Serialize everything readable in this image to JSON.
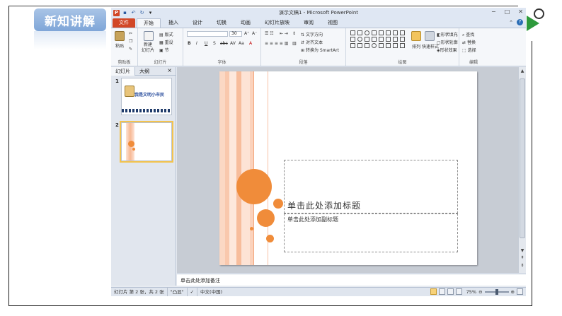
{
  "badge": {
    "label": "新知讲解"
  },
  "window": {
    "title": "演示文稿1 - Microsoft PowerPoint",
    "controls": [
      "−",
      "□",
      "✕"
    ]
  },
  "ribbon": {
    "tabs": [
      "文件",
      "开始",
      "插入",
      "设计",
      "切换",
      "动画",
      "幻灯片放映",
      "审阅",
      "视图"
    ],
    "active_tab": "开始",
    "groups": {
      "clipboard": {
        "label": "剪贴板",
        "paste": "粘贴"
      },
      "slides": {
        "label": "幻灯片",
        "new_slide": "新建\n幻灯片",
        "layout": "版式",
        "reset": "重设",
        "section": "节"
      },
      "font": {
        "label": "字体",
        "size": "30",
        "buttons": [
          "B",
          "I",
          "U",
          "S",
          "abc",
          "AV",
          "Aa",
          "A"
        ]
      },
      "paragraph": {
        "label": "段落",
        "text_direction": "文字方向",
        "align_text": "对齐文本",
        "smartart": "转换为 SmartArt"
      },
      "drawing": {
        "label": "绘图",
        "arrange": "排列",
        "quick_styles": "快速样式",
        "fill": "形状填充",
        "outline": "形状轮廓",
        "effects": "形状效果"
      },
      "editing": {
        "label": "编辑",
        "find": "查找",
        "replace": "替换",
        "select": "选择"
      }
    }
  },
  "left_pane": {
    "tabs": [
      "幻灯片",
      "大纲"
    ],
    "close": "×",
    "slides": [
      {
        "number": "1",
        "caption": "我是文明小市民"
      },
      {
        "number": "2",
        "caption": ""
      }
    ]
  },
  "slide": {
    "title_placeholder": "单击此处添加标题",
    "subtitle_placeholder": "单击此处添加副标题"
  },
  "notes": {
    "placeholder": "单击此处添加备注"
  },
  "status": {
    "slide_info": "幻灯片 第 2 张，共 2 张",
    "theme": "\"凸显\"",
    "language": "中文(中国)",
    "zoom": "75%"
  },
  "colors": {
    "accent_orange": "#f08c3a",
    "file_tab": "#d24726",
    "badge": "#8fb0dc",
    "arrow": "#2e9a3c"
  }
}
